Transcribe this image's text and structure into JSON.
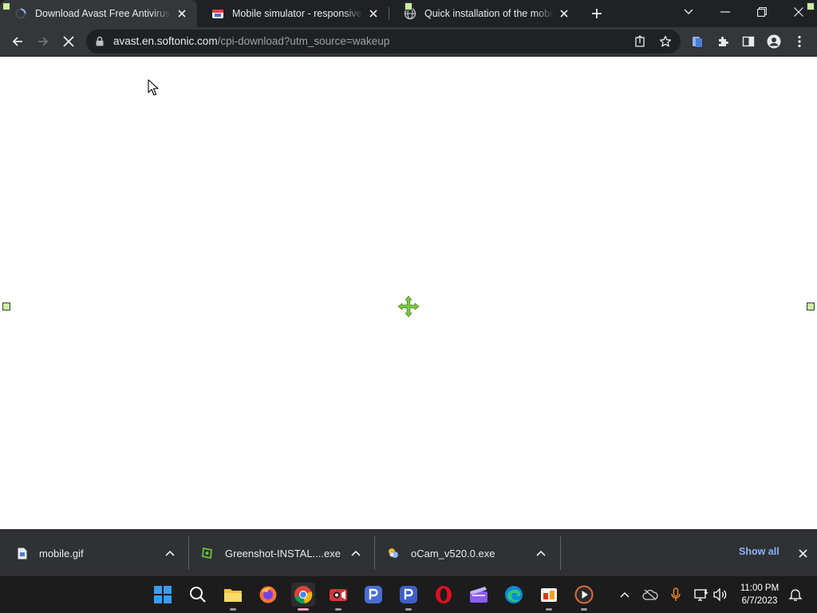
{
  "browser": {
    "tabs": [
      {
        "title": "Download Avast Free Antivirus - ",
        "favicon": "loading-spinner-icon",
        "active": true
      },
      {
        "title": "Mobile simulator - responsive tes",
        "favicon": "mobile-simulator-favicon",
        "active": false
      },
      {
        "title": "Quick installation of the mobile s",
        "favicon": "globe-icon",
        "active": false
      }
    ],
    "address_bar": {
      "host": "avast.en.softonic.com",
      "path": "/cpi-download?utm_source=wakeup"
    }
  },
  "downloads": {
    "items": [
      {
        "name": "mobile.gif",
        "icon": "file-icon"
      },
      {
        "name": "Greenshot-INSTAL....exe",
        "icon": "greenshot-icon"
      },
      {
        "name": "oCam_v520.0.exe",
        "icon": "ocam-icon"
      }
    ],
    "show_all": "Show all"
  },
  "taskbar": {
    "clock": {
      "time": "11:00 PM",
      "date": "6/7/2023"
    }
  },
  "colors": {
    "tab_strip": "#202124",
    "toolbar": "#35363a",
    "omnibox": "#202124",
    "shelf": "#303134",
    "taskbar": "#1c1c1c",
    "link_blue": "#8ab4f8",
    "handle_green": "#c8f0a0",
    "move_green": "#7ac943"
  }
}
